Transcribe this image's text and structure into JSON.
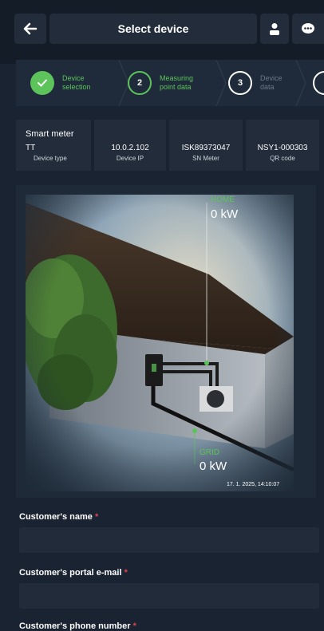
{
  "header": {
    "title": "Select device",
    "icons": [
      "back-arrow-icon",
      "user-icon",
      "chat-icon"
    ]
  },
  "steps": [
    {
      "number": "",
      "label_line1": "Device",
      "label_line2": "selection",
      "state": "done"
    },
    {
      "number": "2",
      "label_line1": "Measuring",
      "label_line2": "point data",
      "state": "active"
    },
    {
      "number": "3",
      "label_line1": "Device",
      "label_line2": "data",
      "state": "todo"
    }
  ],
  "device": {
    "name": "Smart meter",
    "type_value": "TT",
    "type_caption": "Device type",
    "ip_value": "10.0.2.102",
    "ip_caption": "Device IP",
    "sn_value": "ISK89373047",
    "sn_caption": "SN Meter",
    "qr_value": "NSY1-000303",
    "qr_caption": "QR code"
  },
  "energy": {
    "home_label": "HOME",
    "home_value": "0 kW",
    "grid_label": "GRID",
    "grid_value": "0 kW",
    "timestamp": "17. 1. 2025, 14:10:07"
  },
  "form": {
    "name_label": "Customer's name",
    "email_label": "Customer's portal e-mail",
    "phone_label": "Customer's phone number",
    "required_mark": "*"
  },
  "colors": {
    "accent": "#5cc45a",
    "required": "#e0424b",
    "background": "#1a2332"
  }
}
